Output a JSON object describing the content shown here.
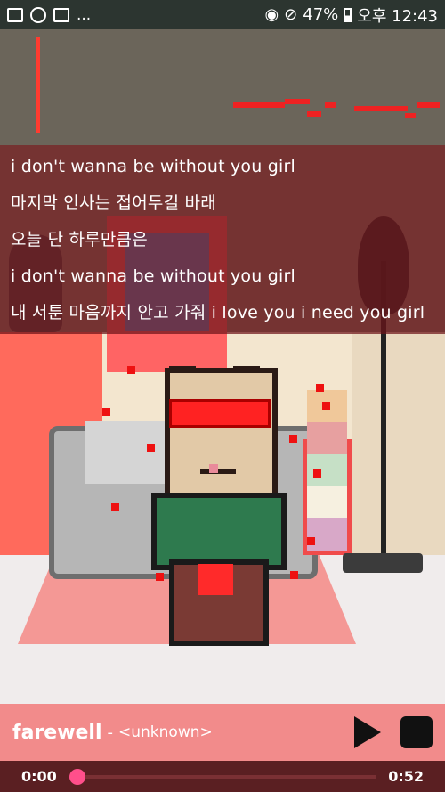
{
  "status_bar": {
    "notif_more": "...",
    "battery": "47%",
    "time": "오후 12:43"
  },
  "lyrics": [
    "i don't wanna be without you girl",
    "마지막 인사는 접어두길 바래",
    "오늘 단 하루만큼은",
    "i don't wanna be without you girl",
    "내 서툰 마음까지 안고 가줘 i love you i need you girl"
  ],
  "player": {
    "title": "farewell",
    "separator": "-",
    "artist": "<unknown>",
    "play_icon": "play-icon",
    "stop_icon": "stop-icon"
  },
  "progress": {
    "current_time": "0:00",
    "total_time": "0:52",
    "fraction": 0.0
  },
  "colors": {
    "status_bar": "#2c3530",
    "lyrics_overlay": "#6e1419",
    "player_bar": "#f28b8b",
    "progress_bar": "#5a1f22",
    "progress_knob": "#ff4f8b"
  }
}
